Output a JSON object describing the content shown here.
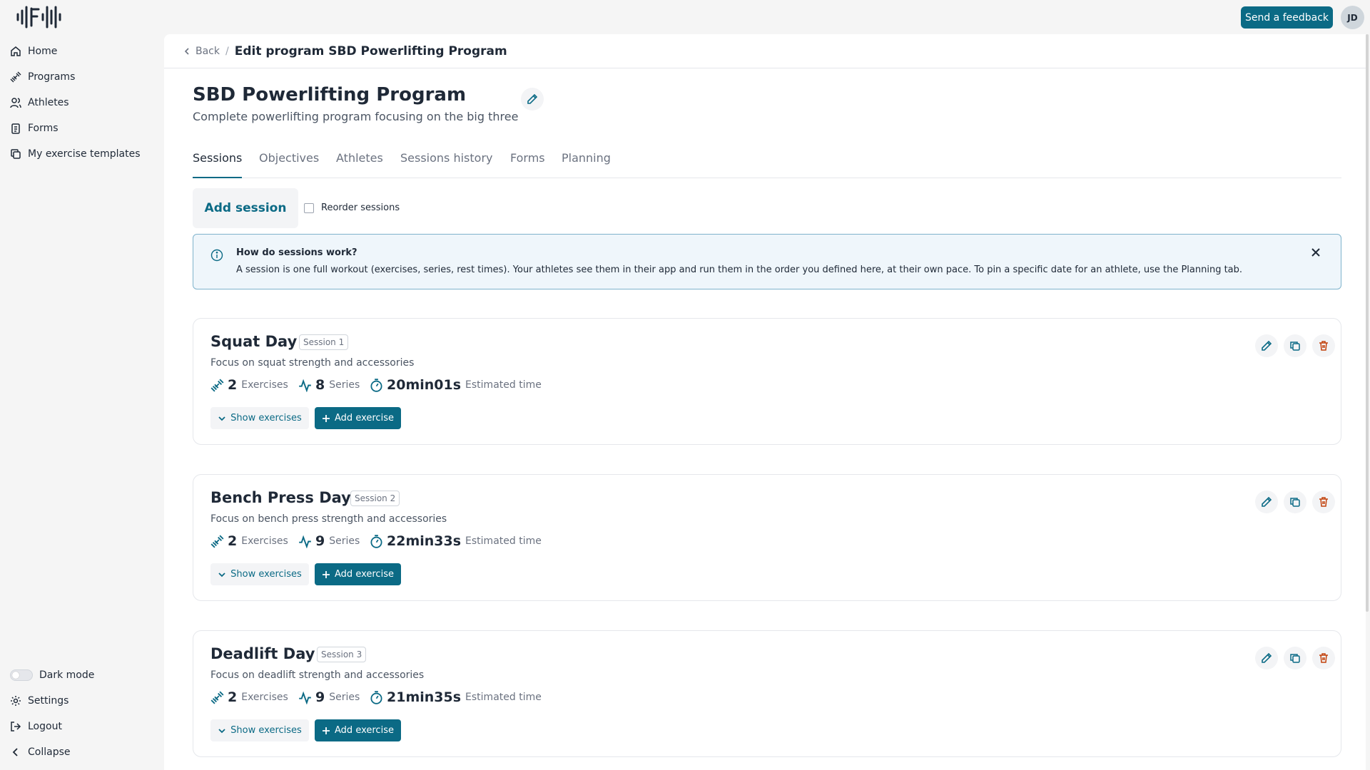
{
  "header": {
    "feedback_label": "Send a feedback",
    "avatar_initials": "JD"
  },
  "sidebar": {
    "items": [
      {
        "label": "Home",
        "icon": "home-icon"
      },
      {
        "label": "Programs",
        "icon": "dumbbell-icon"
      },
      {
        "label": "Athletes",
        "icon": "users-icon"
      },
      {
        "label": "Forms",
        "icon": "clipboard-icon"
      },
      {
        "label": "My exercise templates",
        "icon": "copy-icon"
      }
    ],
    "bottom": {
      "dark_mode": "Dark mode",
      "settings": "Settings",
      "logout": "Logout",
      "collapse": "Collapse"
    }
  },
  "breadcrumb": {
    "back": "Back",
    "separator": "/",
    "title": "Edit program SBD Powerlifting Program"
  },
  "program": {
    "title": "SBD Powerlifting Program",
    "description": "Complete powerlifting program focusing on the big three"
  },
  "tabs": [
    "Sessions",
    "Objectives",
    "Athletes",
    "Sessions history",
    "Forms",
    "Planning"
  ],
  "toolbar": {
    "add_session": "Add session",
    "reorder": "Reorder sessions"
  },
  "info": {
    "title": "How do sessions work?",
    "text": "A session is one full workout (exercises, series, rest times). Your athletes see them in their app and run them in the order you defined here, at their own pace. To pin a specific date for an athlete, use the Planning tab."
  },
  "card_labels": {
    "exercises": "Exercises",
    "series": "Series",
    "estimated": "Estimated time",
    "show_exercises": "Show exercises",
    "add_exercise": "Add exercise"
  },
  "sessions": [
    {
      "name": "Squat Day",
      "badge": "Session 1",
      "description": "Focus on squat strength and accessories",
      "exercises": "2",
      "series": "8",
      "time": "20min01s"
    },
    {
      "name": "Bench Press Day",
      "badge": "Session 2",
      "description": "Focus on bench press strength and accessories",
      "exercises": "2",
      "series": "9",
      "time": "22min33s"
    },
    {
      "name": "Deadlift Day",
      "badge": "Session 3",
      "description": "Focus on deadlift strength and accessories",
      "exercises": "2",
      "series": "9",
      "time": "21min35s"
    }
  ],
  "colors": {
    "accent": "#0b6a85",
    "danger": "#c2410c",
    "info_bg": "#eff6fb"
  }
}
